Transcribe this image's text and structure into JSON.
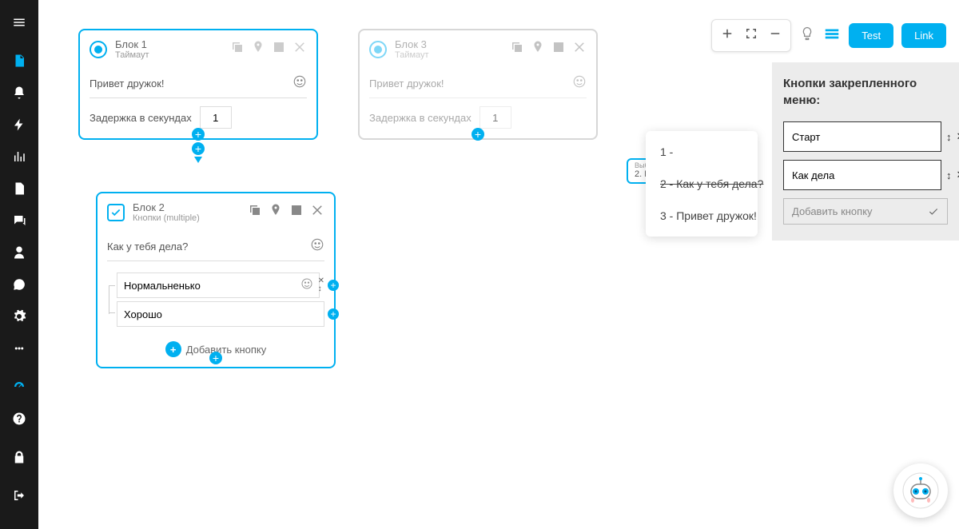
{
  "sidebar": {
    "items": [
      "menu",
      "page",
      "bell",
      "bolt",
      "chart",
      "doc",
      "chat-multi",
      "user",
      "chat",
      "gear",
      "more",
      "dashboard",
      "help",
      "lock",
      "logout"
    ]
  },
  "toolbar": {
    "test": "Test",
    "link": "Link"
  },
  "blocks": {
    "b1": {
      "title": "Блок 1",
      "subtitle": "Таймаут",
      "message": "Привет дружок!",
      "delay_label": "Задержка в секундах",
      "delay_value": "1"
    },
    "b3": {
      "title": "Блок 3",
      "subtitle": "Таймаут",
      "message": "Привет дружок!",
      "delay_label": "Задержка в секундах",
      "delay_value": "1"
    },
    "b2": {
      "title": "Блок 2",
      "subtitle": "Кнопки (multiple)",
      "message": "Как у тебя дела?",
      "btn1": "Нормальненько",
      "btn2": "Хорошо",
      "add": "Добавить кнопку"
    }
  },
  "selector": {
    "label": "Выберите блок",
    "value": "2. Как у тебя дела?",
    "options": {
      "o1": "1 -",
      "o2": "2 - Как у тебя дела?",
      "o3": "3 - Привет дружок!"
    }
  },
  "panel": {
    "heading": "Кнопки закрепленного меню:",
    "btn1": "Старт",
    "btn2": "Как дела",
    "add": "Добавить кнопку"
  }
}
